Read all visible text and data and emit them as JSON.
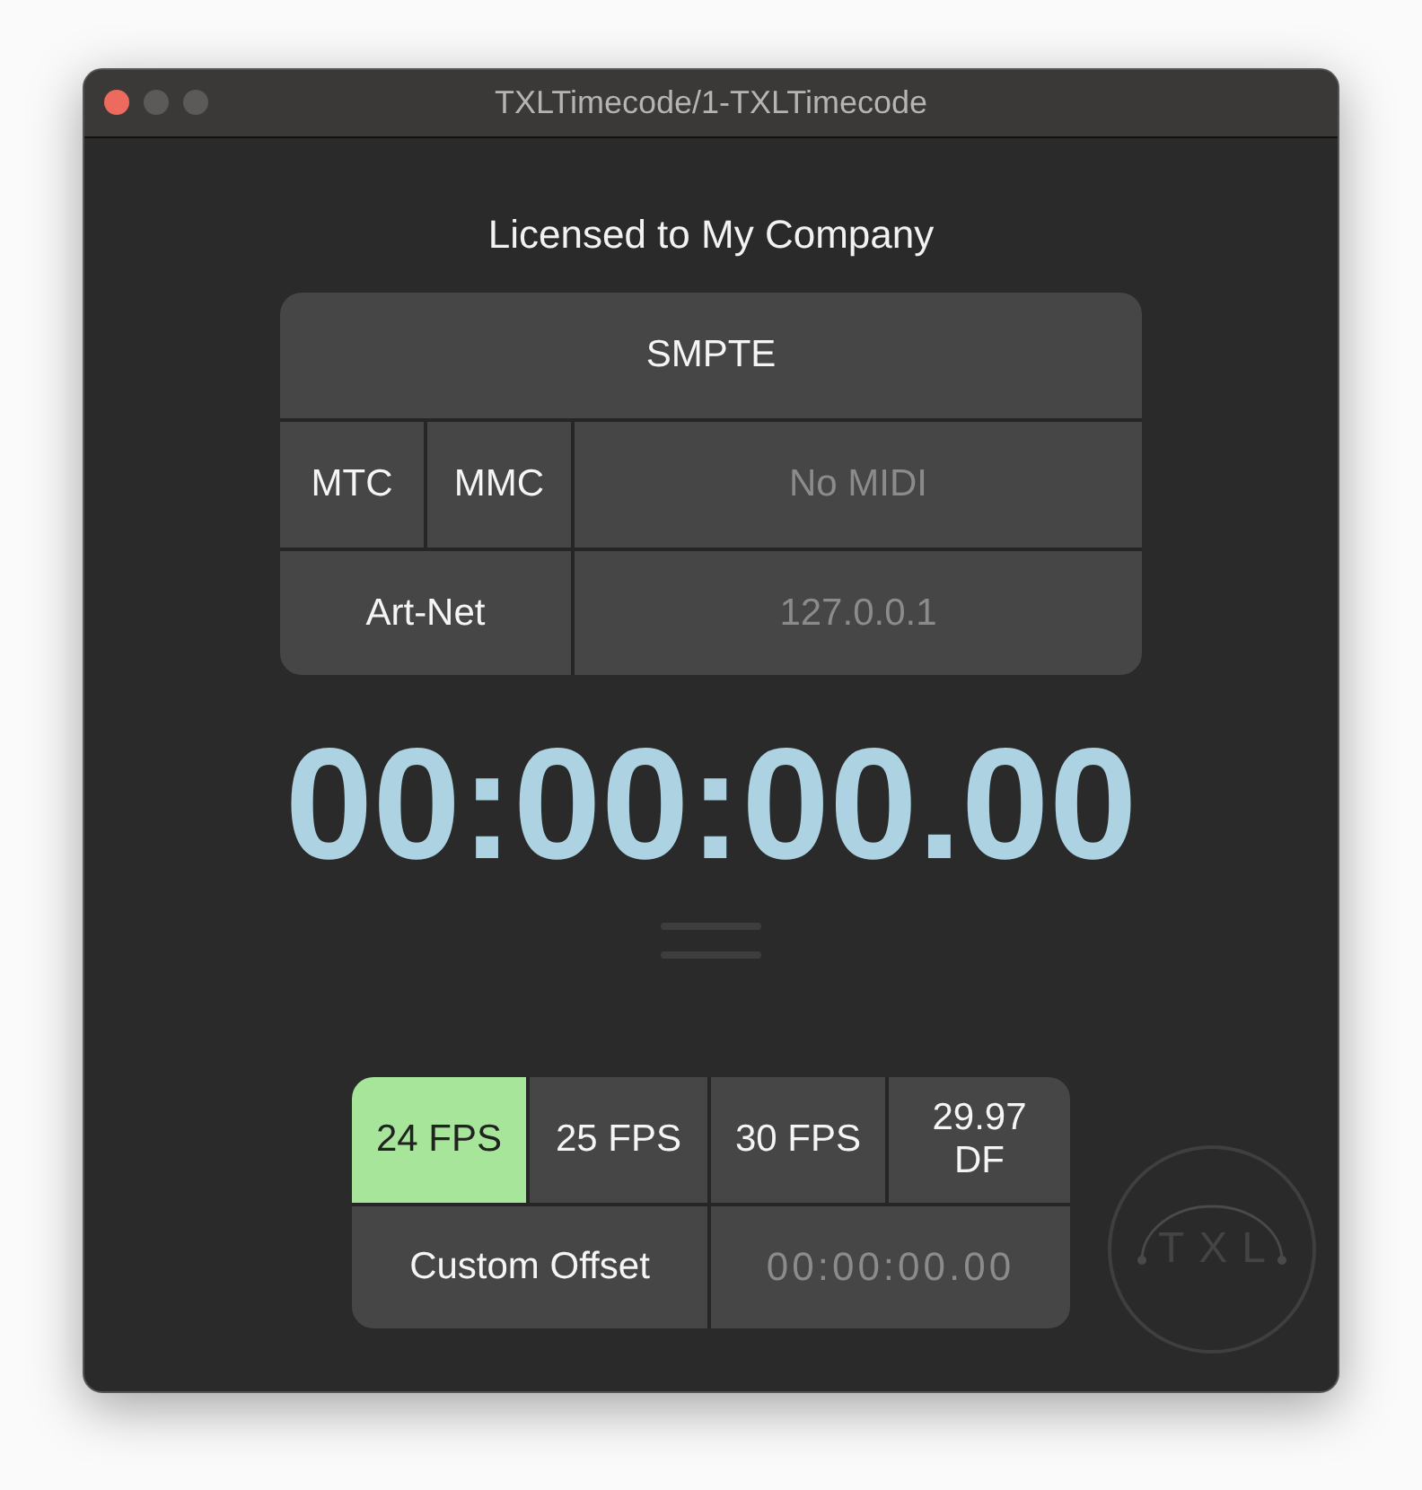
{
  "window": {
    "title": "TXLTimecode/1-TXLTimecode"
  },
  "license": "Licensed to My Company",
  "sources": {
    "smpte": "SMPTE",
    "mtc": "MTC",
    "mmc": "MMC",
    "midi_device": "No MIDI",
    "artnet": "Art-Net",
    "artnet_ip": "127.0.0.1"
  },
  "timecode": "00:00:00.00",
  "frame_rates": [
    {
      "label": "24 FPS",
      "selected": true
    },
    {
      "label": "25 FPS",
      "selected": false
    },
    {
      "label": "30 FPS",
      "selected": false
    },
    {
      "label": "29.97 DF",
      "selected": false
    }
  ],
  "custom_offset": {
    "label": "Custom Offset",
    "placeholder": "00:00:00.00"
  },
  "logo": {
    "text": "TXL"
  }
}
